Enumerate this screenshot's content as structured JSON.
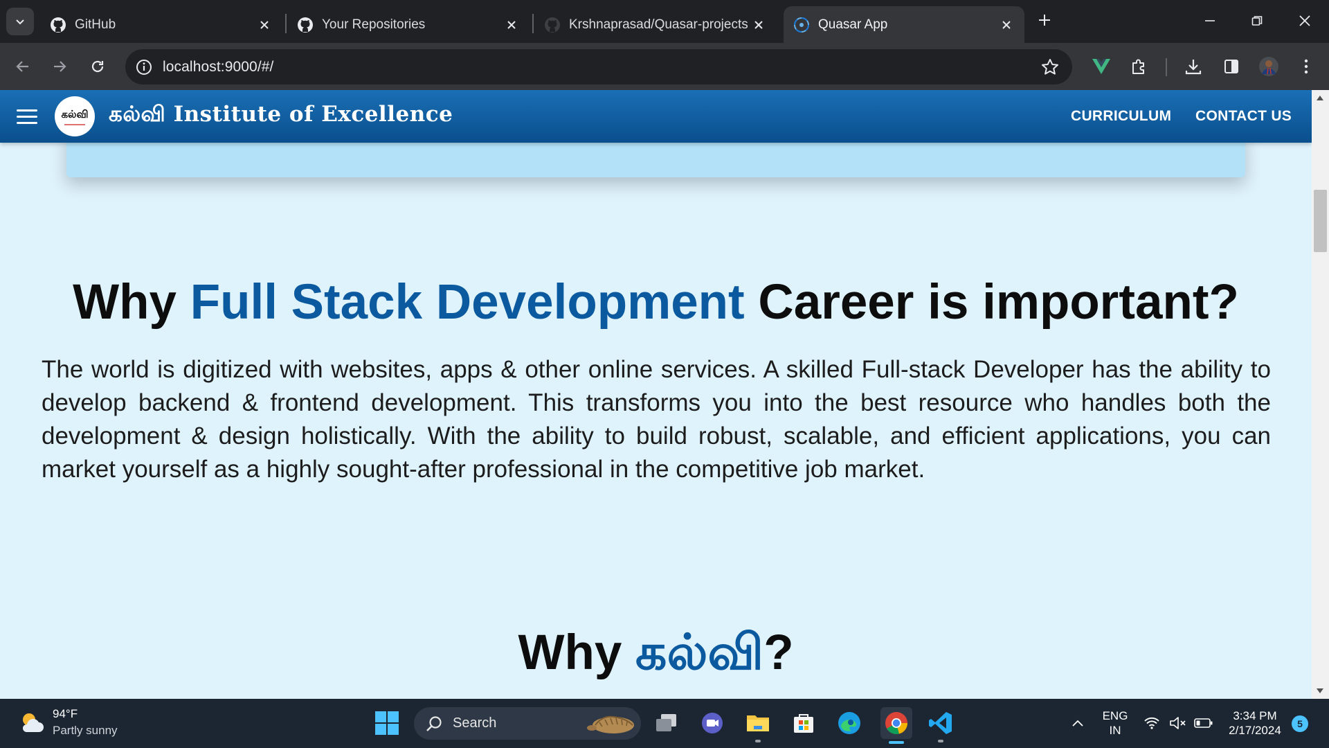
{
  "browser": {
    "tabs": [
      {
        "title": "GitHub",
        "icon": "github-icon",
        "active": false
      },
      {
        "title": "Your Repositories",
        "icon": "github-icon",
        "active": false
      },
      {
        "title": "Krshnaprasad/Quasar-projects",
        "icon": "github-icon",
        "active": false
      },
      {
        "title": "Quasar App",
        "icon": "quasar-icon",
        "active": true
      }
    ],
    "url": "localhost:9000/#/"
  },
  "app": {
    "logo_text": "கல்வி",
    "brand": "கல்வி Institute of Excellence",
    "nav": [
      "CURRICULUM",
      "CONTACT US"
    ]
  },
  "content": {
    "section1": {
      "title_before": "Why ",
      "title_accent": "Full Stack Development",
      "title_after": " Career is important?",
      "paragraph": "The world is digitized with websites, apps & other online services. A skilled Full-stack Developer has the ability to develop backend & frontend development. This transforms you into the best resource who handles both the development & design holistically. With the ability to build robust, scalable, and efficient applications, you can market yourself as a highly sought-after professional in the competitive job market."
    },
    "section2": {
      "title_before": "Why ",
      "title_accent": "கல்வி",
      "title_after": "?"
    }
  },
  "taskbar": {
    "weather_temp": "94°F",
    "weather_desc": "Partly sunny",
    "search_label": "Search",
    "lang_line1": "ENG",
    "lang_line2": "IN",
    "time": "3:34 PM",
    "date": "2/17/2024",
    "notification_count": "5"
  },
  "colors": {
    "accent": "#0b5aa0",
    "header": "#1565a8",
    "page_bg": "#dff3fd"
  }
}
